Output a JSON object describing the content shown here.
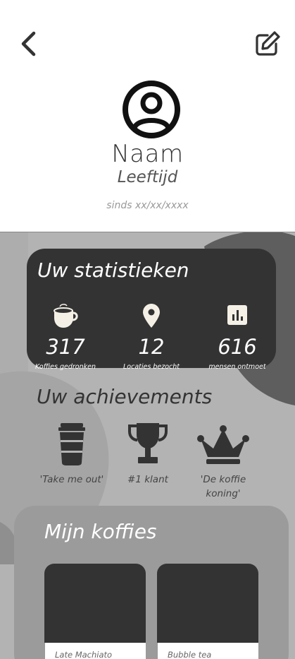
{
  "profile": {
    "name": "Naam",
    "age": "Leeftijd",
    "since": "sinds xx/xx/xxxx"
  },
  "icons": {
    "back": "chevron-left-icon",
    "edit": "edit-icon",
    "avatar": "user-circle-icon"
  },
  "stats": {
    "title": "Uw statistieken",
    "items": [
      {
        "icon": "coffee-cup-icon",
        "value": "317",
        "label": "Koffies gedronken"
      },
      {
        "icon": "location-pin-icon",
        "value": "12",
        "label": "Locaties bezocht"
      },
      {
        "icon": "bar-chart-icon",
        "value": "616",
        "label": "mensen ontmoet"
      }
    ]
  },
  "achievements": {
    "title": "Uw achievements",
    "items": [
      {
        "icon": "takeaway-cup-icon",
        "label": "'Take me out'"
      },
      {
        "icon": "trophy-icon",
        "label": "#1 klant"
      },
      {
        "icon": "crown-icon",
        "label": "'De koffie koning'"
      }
    ]
  },
  "koffies": {
    "title": "Mijn koffies",
    "items": [
      {
        "label": "Late Machiato"
      },
      {
        "label": "Bubble tea"
      }
    ]
  },
  "colors": {
    "dark": "#333333",
    "background": "#b3b3b3",
    "card_panel": "#9b9b9b",
    "accent_light": "#f5f0e6"
  }
}
